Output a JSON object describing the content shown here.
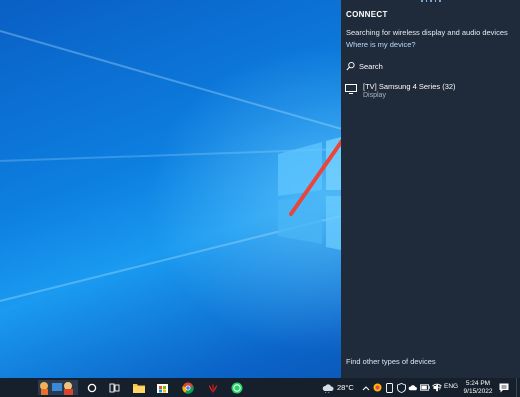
{
  "panel": {
    "title": "CONNECT",
    "searching_text": "Searching for wireless display and audio devices",
    "where_link": "Where is my device?",
    "search_label": "Search",
    "device": {
      "name": "[TV] Samsung 4 Series (32)",
      "type": "Display",
      "icon": "monitor-icon"
    },
    "find_other": "Find other types of devices"
  },
  "taskbar": {
    "weather_temp": "28°C",
    "language": "ENG",
    "time": "5:24 PM",
    "date": "9/15/2022",
    "apps": [
      "news-widget",
      "task-view",
      "cortana",
      "file-explorer",
      "microsoft-store",
      "chrome",
      "huawei",
      "whatsapp"
    ]
  },
  "colors": {
    "panel_bg": "#1f2b3a",
    "taskbar_bg": "#16202c",
    "arrow": "#e8453c",
    "link": "#b9d9ff"
  }
}
